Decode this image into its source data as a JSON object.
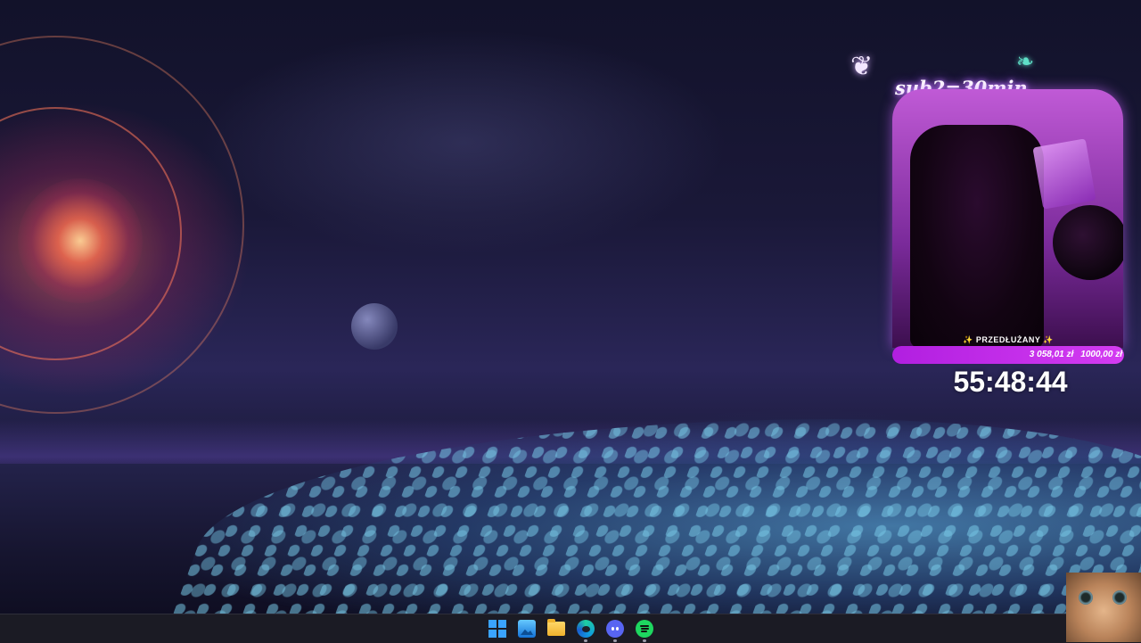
{
  "overlay": {
    "sub_note": "sub2=30min",
    "progress": {
      "label": "✨ PRZEDŁUŻANY ✨",
      "current": "3 058,01 zł",
      "goal": "1000,00 zł",
      "fill_fraction": 1.0
    },
    "timer": "55:48:44"
  },
  "taskbar": {
    "icons": [
      "windows-start-icon",
      "photos-icon",
      "file-explorer-icon",
      "edge-icon",
      "discord-icon",
      "spotify-icon"
    ]
  },
  "colors": {
    "accent": "#c13fe6",
    "taskbar": "#1c1c24"
  }
}
